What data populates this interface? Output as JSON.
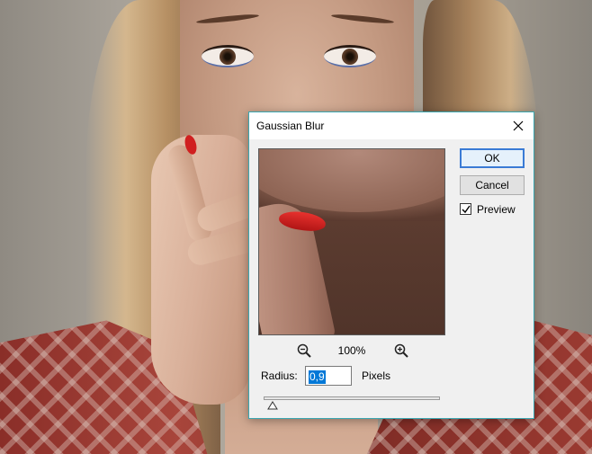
{
  "dialog": {
    "title": "Gaussian Blur",
    "ok_label": "OK",
    "cancel_label": "Cancel",
    "preview_label": "Preview",
    "preview_checked": true,
    "zoom_level": "100%",
    "radius_label": "Radius:",
    "radius_value": "0,9",
    "unit_label": "Pixels",
    "slider_fraction": 0.05,
    "accent_color": "#3a7bd5"
  },
  "icons": {
    "close": "close-icon",
    "zoom_out": "zoom-out-icon",
    "zoom_in": "zoom-in-icon",
    "check": "checkmark-icon",
    "slider": "slider-thumb-icon"
  }
}
